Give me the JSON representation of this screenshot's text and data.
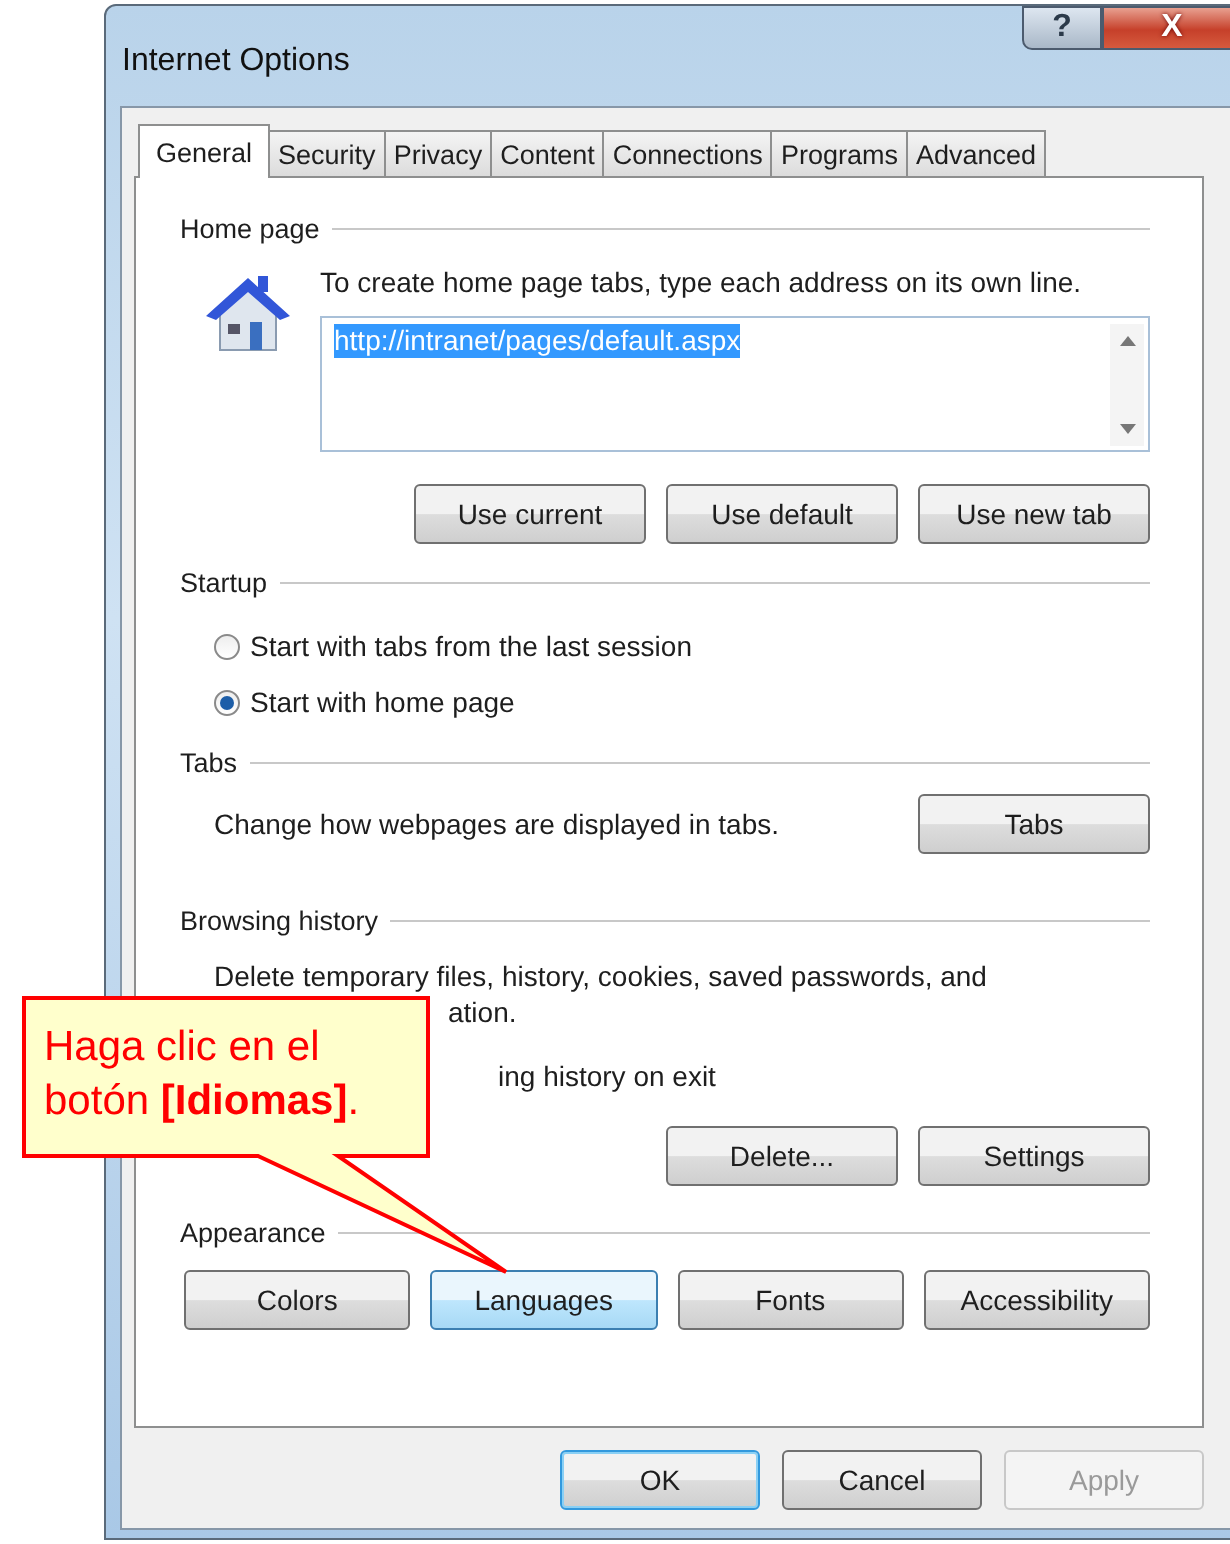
{
  "window": {
    "title": "Internet Options",
    "help_button": "?",
    "close_button": "X"
  },
  "tabs": [
    {
      "label": "General",
      "selected": true
    },
    {
      "label": "Security",
      "selected": false
    },
    {
      "label": "Privacy",
      "selected": false
    },
    {
      "label": "Content",
      "selected": false
    },
    {
      "label": "Connections",
      "selected": false
    },
    {
      "label": "Programs",
      "selected": false
    },
    {
      "label": "Advanced",
      "selected": false
    }
  ],
  "home_page": {
    "label": "Home page",
    "instruction": "To create home page tabs, type each address on its own line.",
    "value": "http://intranet/pages/default.aspx",
    "buttons": [
      {
        "label": "Use current",
        "highlighted": false
      },
      {
        "label": "Use default",
        "highlighted": false
      },
      {
        "label": "Use new tab",
        "highlighted": false
      }
    ]
  },
  "startup": {
    "label": "Startup",
    "options": [
      {
        "label": "Start with tabs from the last session",
        "selected": false
      },
      {
        "label": "Start with home page",
        "selected": true
      }
    ]
  },
  "tabs_group": {
    "label": "Tabs",
    "text": "Change how webpages are displayed in tabs.",
    "button": "Tabs"
  },
  "browsing_history": {
    "label": "Browsing history",
    "text_line_1": "Delete temporary files, history, cookies, saved passwords, and",
    "text_line_2": "ation.",
    "checkbox_label": "ing history on exit",
    "buttons": [
      {
        "label": "Delete...",
        "highlighted": false
      },
      {
        "label": "Settings",
        "highlighted": false
      }
    ]
  },
  "appearance": {
    "label": "Appearance",
    "buttons": [
      {
        "label": "Colors",
        "highlighted": false
      },
      {
        "label": "Languages",
        "highlighted": true
      },
      {
        "label": "Fonts",
        "highlighted": false
      },
      {
        "label": "Accessibility",
        "highlighted": false
      }
    ]
  },
  "footer_buttons": [
    {
      "label": "OK",
      "default": true,
      "disabled": false
    },
    {
      "label": "Cancel",
      "default": false,
      "disabled": false
    },
    {
      "label": "Apply",
      "default": false,
      "disabled": true
    }
  ],
  "callout": {
    "text": "Haga clic en el botón **[Idiomas]**."
  }
}
